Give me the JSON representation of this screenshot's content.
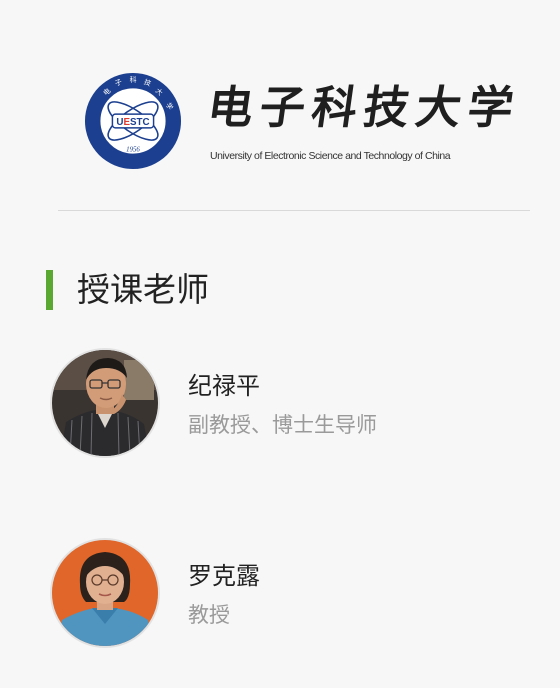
{
  "header": {
    "logo": {
      "seal_text_top": "电子科技大学",
      "seal_abbreviation": "UESTC",
      "seal_year": "1956",
      "name_cn": "电子科技大学",
      "name_en": "University of Electronic Science and Technology of China",
      "color_primary": "#1c3f8f",
      "color_accent": "#e03a2c"
    }
  },
  "section": {
    "title": "授课老师",
    "accent_color": "#5aa832"
  },
  "teachers": [
    {
      "name": "纪禄平",
      "title": "副教授、博士生导师",
      "avatar_icon": "teacher-photo-male"
    },
    {
      "name": "罗克露",
      "title": "教授",
      "avatar_icon": "teacher-photo-female"
    }
  ]
}
